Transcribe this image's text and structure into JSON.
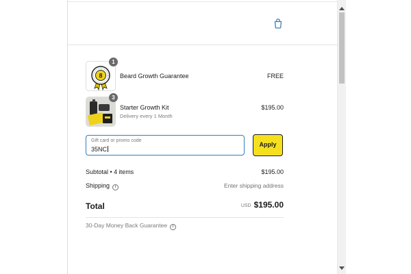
{
  "header": {
    "cart_icon": "shopping-bag-icon"
  },
  "line_items": [
    {
      "title": "Beard Growth Guarantee",
      "subtitle": "",
      "price": "FREE",
      "quantity": "1",
      "badge_ring_text": "BEARD GROWTH GUARANTEE",
      "badge_center": "8",
      "thumbnail": "guarantee-badge-image"
    },
    {
      "title": "Starter Growth Kit",
      "subtitle": "Delivery every 1 Month",
      "price": "$195.00",
      "quantity": "3",
      "thumbnail": "growth-kit-image"
    }
  ],
  "promo": {
    "label": "Gift card or promo code",
    "value": "35NC",
    "apply_label": "Apply"
  },
  "summary": {
    "subtotal_label": "Subtotal • 4 items",
    "subtotal_value": "$195.00",
    "shipping_label": "Shipping",
    "shipping_value": "Enter shipping address",
    "info_icon": "info-circle-icon",
    "total_label": "Total",
    "currency": "USD",
    "total_value": "$195.00"
  },
  "footer": {
    "guarantee": "30-Day Money Back Guarantee"
  },
  "colors": {
    "accent_yellow": "#f6e01d",
    "focus_blue": "#2f7fbf",
    "icon_blue": "#3a7fbd",
    "badge_gray": "#6a6a6a"
  }
}
